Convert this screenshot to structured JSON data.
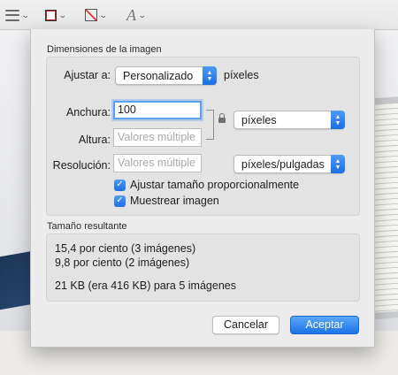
{
  "toolbar": {
    "icons": [
      "list-icon",
      "border-color-icon",
      "fill-color-icon",
      "font-icon"
    ],
    "chevron": "⌄"
  },
  "dialog": {
    "dimensions_title": "Dimensiones de la imagen",
    "fit_label": "Ajustar a:",
    "fit_value": "Personalizado",
    "fit_unit": "píxeles",
    "width_label": "Anchura:",
    "width_value": "100",
    "height_label": "Altura:",
    "height_placeholder": "Valores múltiple",
    "size_unit": "píxeles",
    "resolution_label": "Resolución:",
    "resolution_placeholder": "Valores múltiple",
    "resolution_unit": "píxeles/pulgadas",
    "scale_proportionally": {
      "label": "Ajustar tamaño proporcionalmente",
      "checked": true
    },
    "resample": {
      "label": "Muestrear imagen",
      "checked": true
    },
    "result_title": "Tamaño resultante",
    "result_lines": [
      "15,4 por ciento (3 imágenes)",
      "9,8 por ciento (2 imágenes)",
      "21 KB (era 416 KB) para 5 imágenes"
    ],
    "cancel_label": "Cancelar",
    "ok_label": "Aceptar"
  },
  "colors": {
    "accent": "#1c6fe5",
    "border_icon": "#c62828"
  }
}
